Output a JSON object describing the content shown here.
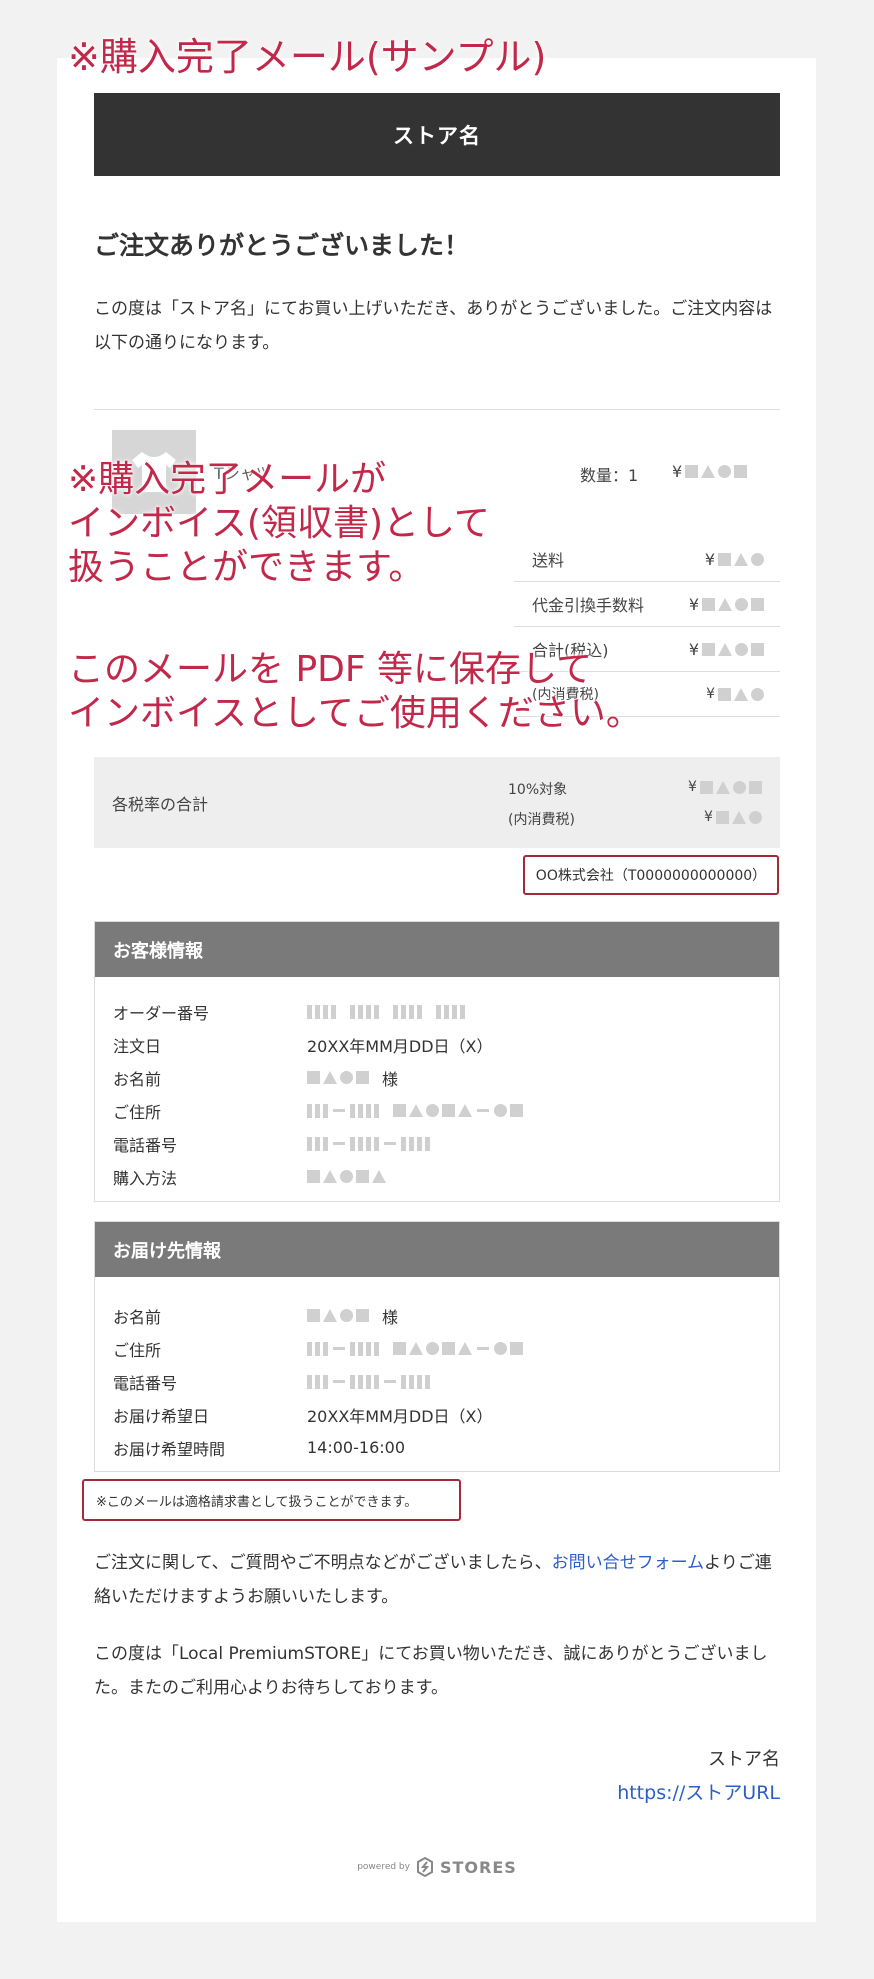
{
  "overlay": {
    "title": "※購入完了メール(サンプル)",
    "note1_line1": "※購入完了メールが",
    "note1_line2": "インボイス(領収書)として",
    "note1_line3": "扱うことができます。",
    "note2_line1": "このメールを PDF 等に保存して",
    "note2_line2": "インボイスとしてご使用ください。"
  },
  "email": {
    "store_name": "ストア名",
    "thanks_title": "ご注文ありがとうございました！",
    "intro": "この度は「ストア名」にてお買い上げいただき、ありがとうございました。ご注文内容は以下の通りになります。",
    "item_name": "Tシャツ",
    "quantity": "数量：1",
    "currency": "¥",
    "summary": [
      {
        "label": "送料"
      },
      {
        "label": "代金引換手数料"
      },
      {
        "label": "合計(税込)"
      },
      {
        "label": "(内消費税)"
      }
    ],
    "tax_summary": {
      "label": "各税率の合計",
      "rate_label": "10%対象",
      "tax_label": "(内消費税)"
    },
    "company": "OO株式会社（T0000000000000）",
    "customer": {
      "title": "お客様情報",
      "order_no_label": "オーダー番号",
      "order_date_label": "注文日",
      "order_date": "20XX年MM月DD日（X）",
      "name_label": "お名前",
      "honorific": "様",
      "address_label": "ご住所",
      "phone_label": "電話番号",
      "payment_label": "購入方法"
    },
    "delivery": {
      "title": "お届け先情報",
      "name_label": "お名前",
      "honorific": "様",
      "address_label": "ご住所",
      "phone_label": "電話番号",
      "date_label": "お届け希望日",
      "date": "20XX年MM月DD日（X）",
      "time_label": "お届け希望時間",
      "time": "14:00-16:00"
    },
    "invoice_note": "※このメールは適格請求書として扱うことができます。",
    "contact_pre": "ご注文に関して、ご質問やご不明点などがございましたら、",
    "contact_link": "お問い合せフォーム",
    "contact_post": "よりご連絡いただけますようお願いいたします。",
    "closing": "この度は「Local PremiumSTORE」にてお買い物いただき、誠にありがとうございました。またのご利用心よりお待ちしております。",
    "signature_name": "ストア名",
    "signature_url": "https://ストアURL",
    "powered_by": "powered by",
    "brand": "STORES"
  },
  "colors": {
    "overlay_text": "#c2284a",
    "header_bg": "#333333",
    "section_head_bg": "#7a7a7a",
    "link": "#2a5fc9",
    "highlight_border": "#a32a3a"
  }
}
